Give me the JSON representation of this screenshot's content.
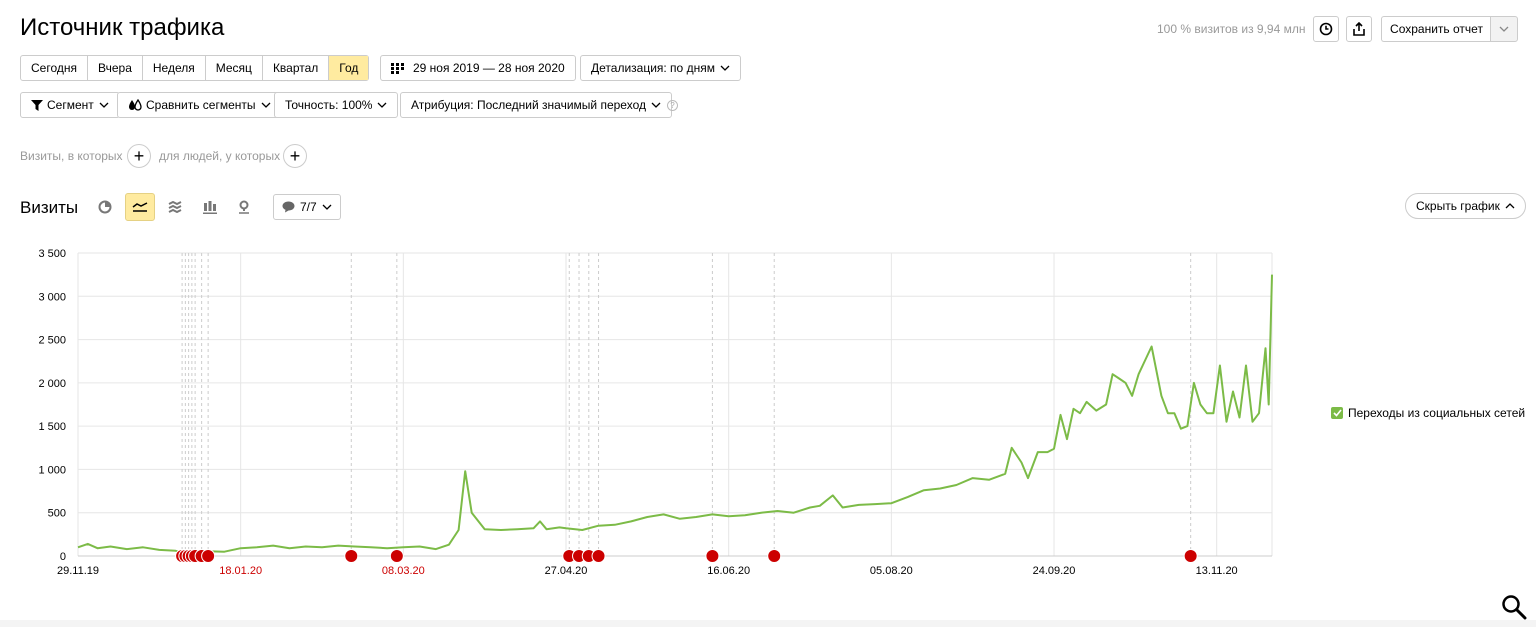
{
  "header": {
    "title": "Источник трафика",
    "meta": "100 % визитов из 9,94 млн",
    "save_label": "Сохранить отчет"
  },
  "periods": [
    "Сегодня",
    "Вчера",
    "Неделя",
    "Месяц",
    "Квартал",
    "Год"
  ],
  "active_period": "Год",
  "date_range": "29 ноя 2019 — 28 ноя 2020",
  "detail": "Детализация: по дням",
  "filters": {
    "segment": "Сегмент",
    "compare": "Сравнить сегменты",
    "accuracy": "Точность: 100%",
    "attribution": "Атрибуция: Последний значимый переход",
    "help": "?"
  },
  "conditions": {
    "visits": "Визиты, в которых",
    "people": "для людей, у которых",
    "plus": "+"
  },
  "chart_section": {
    "title": "Визиты",
    "annotations_count": "7/7",
    "hide_label": "Скрыть график"
  },
  "colors": {
    "accent": "#ffeba0",
    "line": "#7cbb47",
    "note": "#cc0000"
  },
  "chart_data": {
    "type": "line",
    "ylim": [
      0,
      3500
    ],
    "yticks": [
      "0",
      "500",
      "1 000",
      "1 500",
      "2 000",
      "2 500",
      "3 000",
      "3 500"
    ],
    "xticks": [
      {
        "label": "29.11.19",
        "day": 0,
        "holiday": false
      },
      {
        "label": "18.01.20",
        "day": 50,
        "holiday": true
      },
      {
        "label": "08.03.20",
        "day": 100,
        "holiday": true
      },
      {
        "label": "27.04.20",
        "day": 150,
        "holiday": false
      },
      {
        "label": "16.06.20",
        "day": 200,
        "holiday": false
      },
      {
        "label": "05.08.20",
        "day": 250,
        "holiday": false
      },
      {
        "label": "24.09.20",
        "day": 300,
        "holiday": false
      },
      {
        "label": "13.11.20",
        "day": 350,
        "holiday": false
      }
    ],
    "series": [
      {
        "name": "Переходы из социальных сетей",
        "points": [
          [
            0,
            100
          ],
          [
            3,
            140
          ],
          [
            6,
            90
          ],
          [
            10,
            110
          ],
          [
            15,
            80
          ],
          [
            20,
            100
          ],
          [
            25,
            70
          ],
          [
            30,
            60
          ],
          [
            33,
            30
          ],
          [
            36,
            40
          ],
          [
            40,
            55
          ],
          [
            45,
            50
          ],
          [
            50,
            90
          ],
          [
            55,
            100
          ],
          [
            60,
            120
          ],
          [
            65,
            90
          ],
          [
            70,
            110
          ],
          [
            75,
            100
          ],
          [
            80,
            120
          ],
          [
            85,
            110
          ],
          [
            90,
            100
          ],
          [
            95,
            90
          ],
          [
            100,
            100
          ],
          [
            105,
            110
          ],
          [
            110,
            80
          ],
          [
            114,
            130
          ],
          [
            117,
            300
          ],
          [
            119,
            980
          ],
          [
            121,
            500
          ],
          [
            125,
            310
          ],
          [
            130,
            300
          ],
          [
            135,
            310
          ],
          [
            140,
            320
          ],
          [
            142,
            400
          ],
          [
            144,
            310
          ],
          [
            148,
            330
          ],
          [
            150,
            320
          ],
          [
            155,
            300
          ],
          [
            160,
            350
          ],
          [
            165,
            360
          ],
          [
            170,
            400
          ],
          [
            175,
            450
          ],
          [
            180,
            480
          ],
          [
            185,
            430
          ],
          [
            190,
            450
          ],
          [
            195,
            480
          ],
          [
            200,
            460
          ],
          [
            205,
            470
          ],
          [
            210,
            500
          ],
          [
            215,
            520
          ],
          [
            220,
            500
          ],
          [
            225,
            560
          ],
          [
            228,
            580
          ],
          [
            232,
            700
          ],
          [
            235,
            560
          ],
          [
            240,
            590
          ],
          [
            245,
            600
          ],
          [
            250,
            610
          ],
          [
            255,
            680
          ],
          [
            260,
            760
          ],
          [
            265,
            780
          ],
          [
            270,
            820
          ],
          [
            275,
            900
          ],
          [
            280,
            880
          ],
          [
            285,
            950
          ],
          [
            287,
            1250
          ],
          [
            290,
            1080
          ],
          [
            292,
            900
          ],
          [
            295,
            1200
          ],
          [
            298,
            1200
          ],
          [
            300,
            1240
          ],
          [
            302,
            1630
          ],
          [
            304,
            1350
          ],
          [
            306,
            1700
          ],
          [
            308,
            1650
          ],
          [
            310,
            1780
          ],
          [
            313,
            1680
          ],
          [
            316,
            1750
          ],
          [
            318,
            2100
          ],
          [
            320,
            2050
          ],
          [
            322,
            2000
          ],
          [
            324,
            1850
          ],
          [
            326,
            2100
          ],
          [
            330,
            2420
          ],
          [
            333,
            1850
          ],
          [
            335,
            1650
          ],
          [
            337,
            1650
          ],
          [
            339,
            1470
          ],
          [
            341,
            1500
          ],
          [
            343,
            2000
          ],
          [
            345,
            1750
          ],
          [
            347,
            1650
          ],
          [
            349,
            1650
          ],
          [
            351,
            2200
          ],
          [
            353,
            1550
          ],
          [
            355,
            1900
          ],
          [
            357,
            1600
          ],
          [
            359,
            2200
          ],
          [
            361,
            1550
          ],
          [
            363,
            1650
          ],
          [
            365,
            2400
          ],
          [
            366,
            1750
          ],
          [
            367,
            3250
          ]
        ]
      }
    ],
    "note_days": [
      32,
      33,
      34,
      35,
      36,
      38,
      40,
      84,
      98,
      151,
      154,
      157,
      160,
      195,
      214,
      342
    ]
  }
}
